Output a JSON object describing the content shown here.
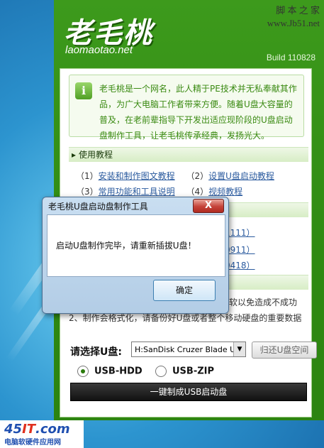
{
  "site_watermark": {
    "name": "脚 本 之 家",
    "url": "www.Jb51.net"
  },
  "app": {
    "logo_cn": "老毛桃",
    "logo_en": "laomaotao.net",
    "build": "Build 110828"
  },
  "intro": {
    "icon": "info-icon",
    "text": "老毛桃是一个网名，此人精于PE技术并无私奉献其作品，为广大电脑工作者带来方便。随着U盘大容量的普及，在老前辈指导下开发出适应现阶段的U盘启动盘制作工具，让老毛桃传承经典，发扬光大。"
  },
  "tutorial": {
    "header": "使用教程",
    "links": [
      {
        "num": "（1）",
        "label": "安装和制作图文教程"
      },
      {
        "num": "（2）",
        "label": "设置U盘启动教程"
      },
      {
        "num": "（3）",
        "label": "常用功能和工具说明"
      },
      {
        "num": "（4）",
        "label": "视频教程"
      }
    ]
  },
  "partial_rows": [
    "1111）",
    "0911）",
    "0418）"
  ],
  "warning_lines": [
    "软以免造成不成功",
    "2、制作会格式化，请备份好U盘或者整个移动硬盘的重要数据"
  ],
  "controls": {
    "choose_label": "请选择U盘:",
    "selected_drive": "H:SanDisk Cruzer Blade US",
    "restore_button": "归还U盘空间",
    "radio_hdd": "USB-HDD",
    "radio_zip": "USB-ZIP",
    "make_button": "一键制成USB启动盘"
  },
  "dialog": {
    "title": "老毛桃U盘启动盘制作工具",
    "close": "X",
    "message": "启动U盘制作完毕，请重新插拔U盘！",
    "ok": "确定"
  },
  "bottom_watermark": {
    "logo_a": "45",
    "logo_b": "IT",
    "logo_c": ".com",
    "sub": "电脑软硬件应用网"
  }
}
